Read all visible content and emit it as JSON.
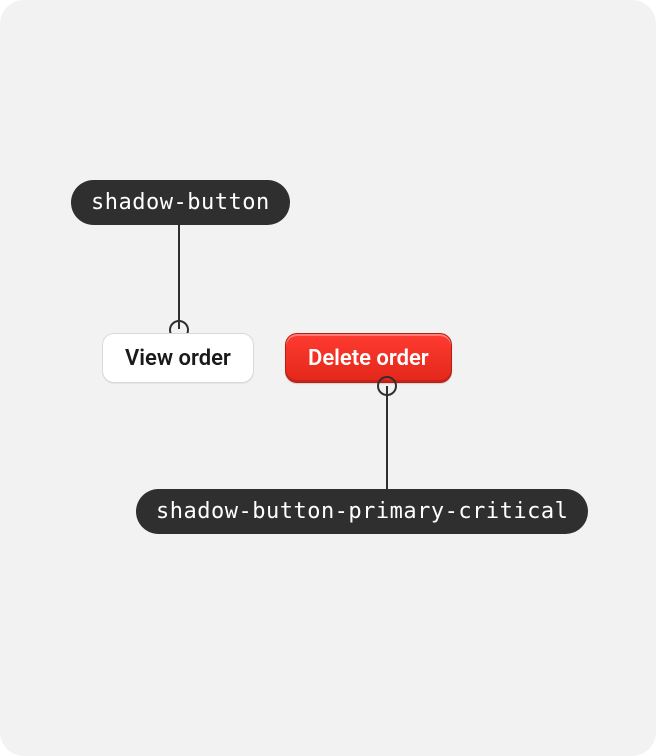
{
  "annotations": {
    "top_token": "shadow-button",
    "bottom_token": "shadow-button-primary-critical"
  },
  "buttons": {
    "view_label": "View order",
    "delete_label": "Delete order"
  },
  "colors": {
    "critical": "#e3271b",
    "label_bg": "#2f2f2f"
  }
}
